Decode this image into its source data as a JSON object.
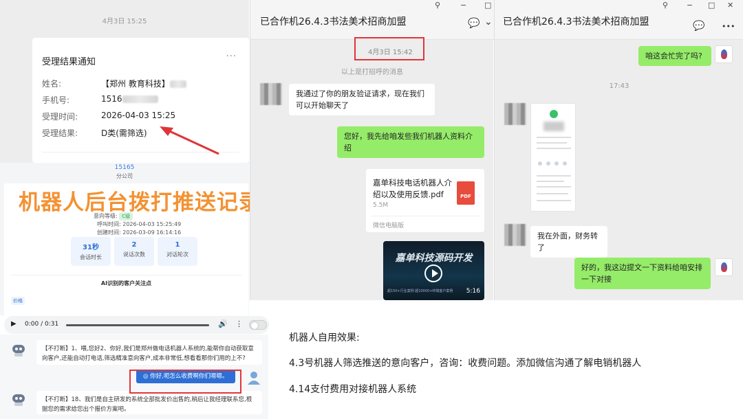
{
  "panel1": {
    "timestamp": "4月3日 15:25",
    "card": {
      "title": "受理结果通知",
      "more": "···",
      "rows": [
        {
          "label": "姓名:",
          "value": "【郑州 教育科技】"
        },
        {
          "label": "手机号:",
          "value": "1516"
        },
        {
          "label": "受理时间:",
          "value": "2026-04-03 15:25"
        },
        {
          "label": "受理结果:",
          "value": "D类(需筛选)"
        }
      ]
    }
  },
  "record": {
    "phone": "15165",
    "company": "分公司",
    "intent_label": "意向等级:",
    "intent_tag": "C级",
    "call_time": "呼叫时间:  2026-04-03 15:25:49",
    "create_time": "创建时间:  2026-03-09 16:14:16",
    "stats": [
      {
        "value": "31秒",
        "label": "会话时长"
      },
      {
        "value": "2",
        "label": "说话次数"
      },
      {
        "value": "1",
        "label": "对话轮次"
      }
    ],
    "ai_title": "AI识别的客户关注点",
    "tag": "价格"
  },
  "overlay_title": "机器人后台拨打推送记录",
  "audio": {
    "play": "▶",
    "time": "0:00 / 0:31",
    "vol": "🔊",
    "more": "⋮"
  },
  "chat2": {
    "bot_msg1": "【不打断】1、喂,您好2、你好,我们是郑州做电话机器人系统的,能帮你自动获取意向客户,还能自动打电话,筛选精准意向客户,成本非常低,想看看那你们用的上不?",
    "user_msg": "◎ 你好,呃怎么收费啊你们嗯嗯。",
    "bot_msg2": "【不打断】18、我们是自主研发的系统全部批发价出售的,稍后让我经理联系您,根据您的需求给您出个报价方案吧。"
  },
  "effect": {
    "heading": "机器人自用效果:",
    "line1": "4.3号机器人筛选推送的意向客户，咨询：收费问题。添加微信沟通了解电销机器人",
    "line2": "4.14支付费用对接机器人系统"
  },
  "panel2": {
    "title": "已合作机26.4.3书法美术招商加盟",
    "pin": "⚲",
    "minimize": "−",
    "maximize": "□",
    "chat_icon": "💬",
    "chevron": "⌄",
    "timestamp": "4月3日 15:42",
    "system_msg": "以上是打招呼的消息",
    "msg_in1": "我通过了你的朋友验证请求，现在我们可以开始聊天了",
    "msg_out1": "您好，我先给咱发些我们机器人资料介绍",
    "file": {
      "name": "嘉单科技电话机器人介绍以及使用反馈.pdf",
      "size": "5.5M",
      "source": "微信电脑版",
      "icon_text": "PDF"
    },
    "video": {
      "title": "嘉单科技源码开发",
      "duration": "5:16",
      "sub": "超150+行业案例 超10000+终端客户案例"
    }
  },
  "panel3": {
    "title": "已合作机26.4.3书法美术招商加盟",
    "pin": "⚲",
    "minimize": "−",
    "maximize": "□",
    "close": "✕",
    "chat_icon": "💬",
    "more": "•••",
    "msg_out1": "咱这会忙完了吗?",
    "timestamp": "17:43",
    "msg_in1": "我在外面，财务转了",
    "msg_out2": "好的，我这边提文一下资料给咱安排一下对接"
  },
  "colors": {
    "accent_red": "#e0343a",
    "overlay_orange": "#f39233",
    "wechat_green": "#95ec69",
    "link_blue": "#2e6fd6"
  }
}
